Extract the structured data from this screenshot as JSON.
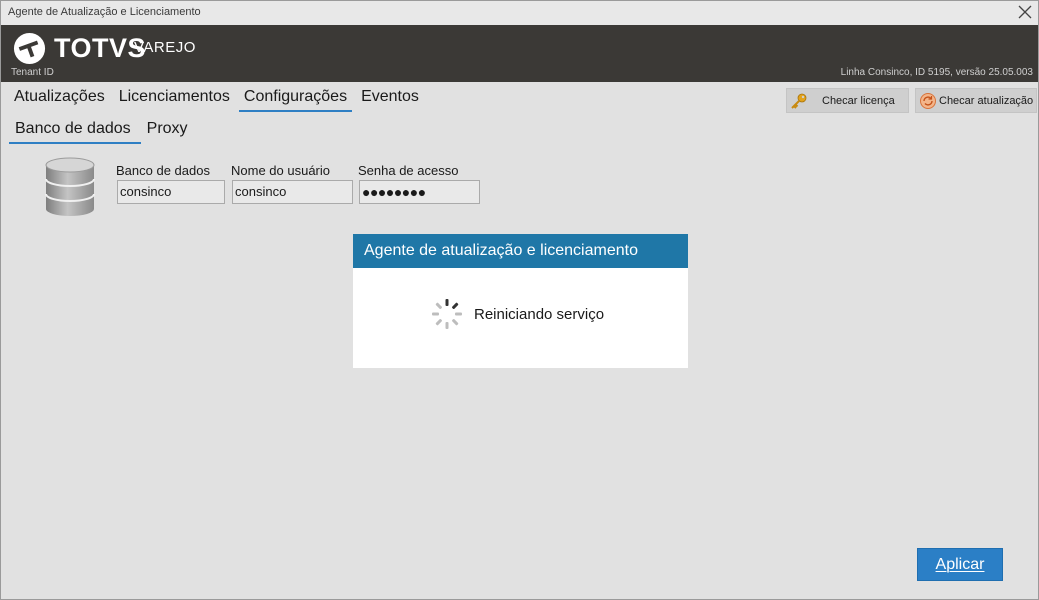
{
  "window": {
    "title": "Agente de Atualização e Licenciamento"
  },
  "brand": {
    "name": "TOTVS",
    "product": "VAREJO",
    "tenant_label": "Tenant ID",
    "version_text": "Linha Consinco, ID 5195, versão 25.05.003"
  },
  "tabs": [
    {
      "label": "Atualizações",
      "active": false
    },
    {
      "label": "Licenciamentos",
      "active": false
    },
    {
      "label": "Configurações",
      "active": true
    },
    {
      "label": "Eventos",
      "active": false
    }
  ],
  "subtabs": [
    {
      "label": "Banco de dados",
      "active": true
    },
    {
      "label": "Proxy",
      "active": false
    }
  ],
  "toolbar": {
    "check_license": "Checar licença",
    "check_update": "Checar atualização"
  },
  "database": {
    "db_label": "Banco de dados",
    "db_value": "consinco",
    "user_label": "Nome do usuário",
    "user_value": "consinco",
    "password_label": "Senha de acesso",
    "password_value": "●●●●●●●●"
  },
  "modal": {
    "title": "Agente de atualização e licenciamento",
    "message": "Reiniciando serviço"
  },
  "apply_label": "Aplicar",
  "colors": {
    "header_bg": "#3b3936",
    "accent": "#2e7fc4",
    "modal_header": "#1f77a7",
    "apply_bg": "#2b7fc6"
  }
}
